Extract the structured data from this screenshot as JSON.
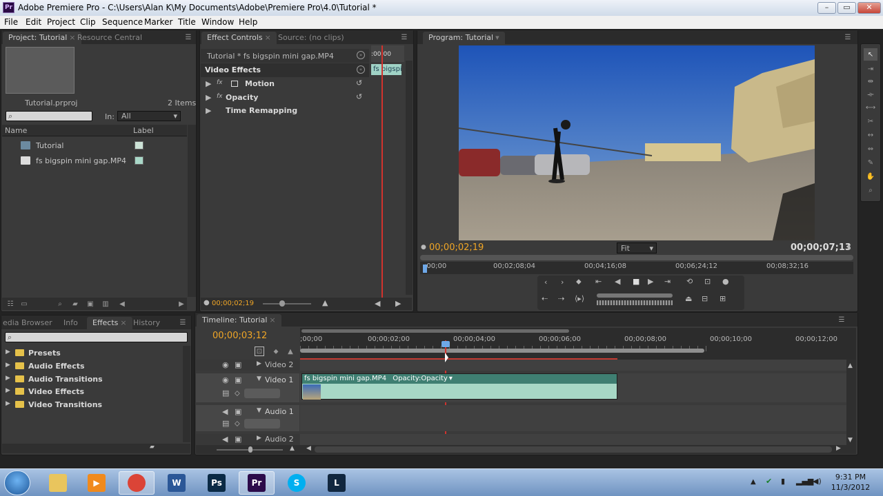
{
  "window": {
    "title": "Adobe Premiere Pro - C:\\Users\\Alan K\\My Documents\\Adobe\\Premiere Pro\\4.0\\Tutorial *",
    "logo": "Pr",
    "min_glyph": "–",
    "max_glyph": "▭",
    "close_glyph": "✕"
  },
  "menu": [
    "File",
    "Edit",
    "Project",
    "Clip",
    "Sequence",
    "Marker",
    "Title",
    "Window",
    "Help"
  ],
  "project_panel": {
    "tabs": [
      "Project: Tutorial",
      "Resource Central"
    ],
    "filename": "Tutorial.prproj",
    "item_count": "2 Items",
    "in_label": "In:",
    "in_value": "All",
    "col_name": "Name",
    "col_label": "Label",
    "items": [
      {
        "name": "Tutorial",
        "color": "#cde3d7"
      },
      {
        "name": "fs bigspin mini gap.MP4",
        "color": "#a9d8c8"
      }
    ]
  },
  "effect_controls": {
    "tabs": [
      "Effect Controls",
      "Source: (no clips)"
    ],
    "clip_path": "Tutorial * fs bigspin mini gap.MP4",
    "ruler_time": ":00:00",
    "mini_clip": "fs bigspi",
    "section": "Video Effects",
    "effects": [
      "Motion",
      "Opacity",
      "Time Remapping"
    ],
    "fx_glyph": "fx",
    "timecode": "00;00;02;19"
  },
  "program_monitor": {
    "tab": "Program: Tutorial",
    "current_time": "00;00;02;19",
    "duration": "00;00;07;13",
    "fit": "Fit",
    "ruler_labels": [
      ";00;00",
      "00;02;08;04",
      "00;04;16;08",
      "00;06;24;12",
      "00;08;32;16"
    ]
  },
  "effects_panel": {
    "tabs": [
      "edia Browser",
      "Info",
      "Effects",
      "History"
    ],
    "folders": [
      "Presets",
      "Audio Effects",
      "Audio Transitions",
      "Video Effects",
      "Video Transitions"
    ]
  },
  "timeline": {
    "tab": "Timeline: Tutorial",
    "timecode": "00;00;03;12",
    "ruler_labels": [
      ";00;00",
      "00;00;02;00",
      "00;00;04;00",
      "00;00;06;00",
      "00;00;08;00",
      "00;00;10;00",
      "00;00;12;00"
    ],
    "tracks": [
      "Video 2",
      "Video 1",
      "Audio 1",
      "Audio 2"
    ],
    "clip_name": "fs bigspin mini gap.MP4",
    "clip_effect": "Opacity:Opacity"
  },
  "tools": [
    "selection",
    "track-select",
    "ripple-edit",
    "rolling-edit",
    "rate-stretch",
    "razor",
    "slip",
    "slide",
    "pen",
    "hand",
    "zoom"
  ],
  "taskbar": {
    "apps": [
      {
        "name": "explorer",
        "label": "",
        "color": "#e9c55d"
      },
      {
        "name": "media",
        "label": "▶",
        "color": "#f08a1d"
      },
      {
        "name": "chrome",
        "label": "",
        "color": "#db4437"
      },
      {
        "name": "word",
        "label": "W",
        "color": "#2b5797"
      },
      {
        "name": "photoshop",
        "label": "Ps",
        "color": "#0a2a45"
      },
      {
        "name": "premiere",
        "label": "Pr",
        "color": "#2c0b4a"
      },
      {
        "name": "skype",
        "label": "S",
        "color": "#00aff0"
      },
      {
        "name": "league",
        "label": "L",
        "color": "#11273f"
      }
    ],
    "time": "9:31 PM",
    "date": "11/3/2012"
  }
}
